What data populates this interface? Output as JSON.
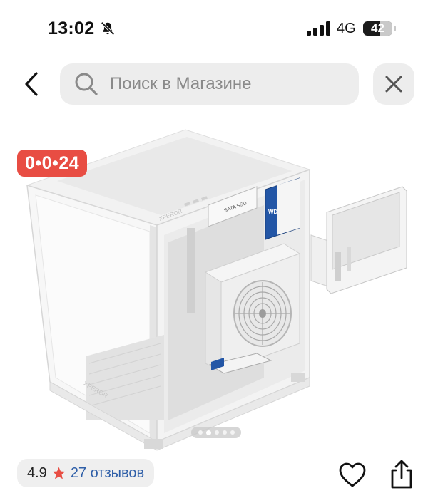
{
  "status_bar": {
    "time": "13:02",
    "network": "4G",
    "battery": "42",
    "icons": [
      "bell-slash-icon",
      "cellular-signal-icon",
      "battery-icon"
    ]
  },
  "nav": {
    "back_icon": "chevron-left-icon",
    "search_placeholder": "Поиск в Магазине",
    "search_value": "",
    "search_icon": "magnifier-icon",
    "close_icon": "close-icon"
  },
  "product": {
    "promo_badge": "0•0•24",
    "image_description_icon": "product-photo-pc-case",
    "gallery_pages": 5,
    "gallery_active_page": 2,
    "case_labels": [
      "SATA SSD",
      "WD",
      "XPEROR"
    ]
  },
  "rating": {
    "value": "4.9",
    "reviews": "27 отзывов",
    "star_color": "#e84d43"
  },
  "actions": {
    "favorite_icon": "heart-icon",
    "share_icon": "share-icon"
  },
  "colors": {
    "badge": "#e84d43",
    "link": "#2f5fa8",
    "field_bg": "#ededed"
  }
}
